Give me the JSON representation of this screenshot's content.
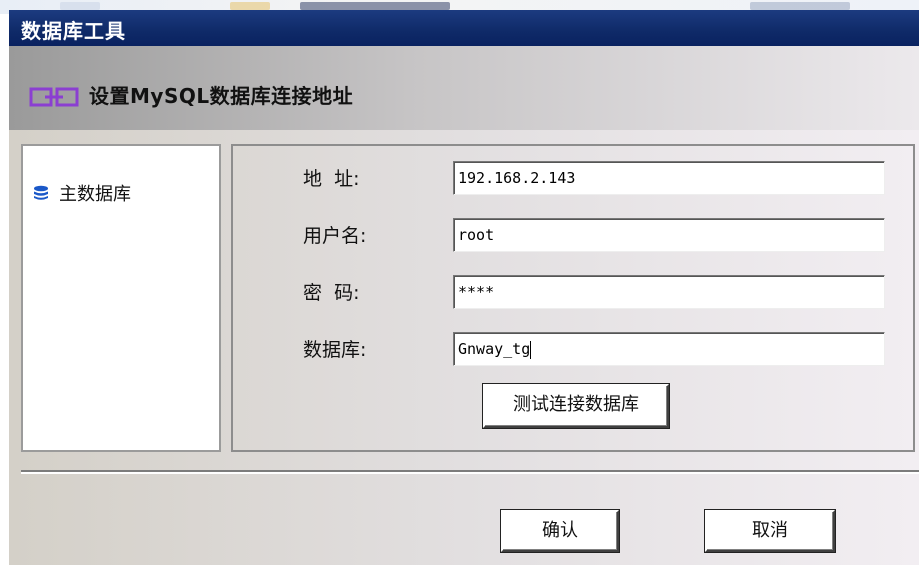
{
  "window": {
    "title": "数据库工具"
  },
  "header": {
    "text": "设置MySQL数据库连接地址",
    "icon": "link-icon"
  },
  "sidebar": {
    "items": [
      {
        "label": "主数据库",
        "icon": "database-icon"
      }
    ]
  },
  "form": {
    "address": {
      "label": "地  址:",
      "value": "192.168.2.143"
    },
    "username": {
      "label": "用户名:",
      "value": "root"
    },
    "password": {
      "label": "密  码:",
      "value": "****"
    },
    "database": {
      "label": "数据库:",
      "value": "Gnway_tg"
    },
    "test_button": "测试连接数据库"
  },
  "footer": {
    "ok_label": "确认",
    "cancel_label": "取消"
  },
  "colors": {
    "titlebar": "#0f2a68",
    "header_icon": "#8b3fd1",
    "db_icon": "#1a58c8"
  }
}
